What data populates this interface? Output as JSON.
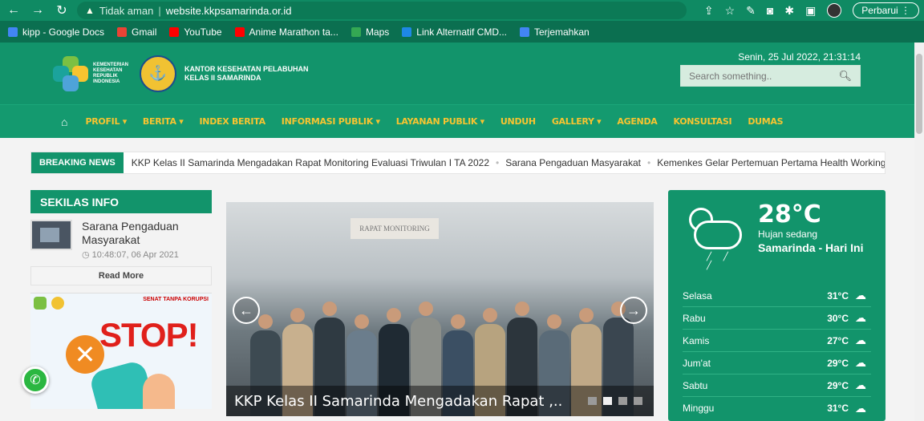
{
  "browser": {
    "insecure_label": "Tidak aman",
    "url": "website.kkpsamarinda.or.id",
    "update_label": "Perbarui"
  },
  "bookmarks": [
    {
      "label": "kipp - Google Docs",
      "color": "#4285f4"
    },
    {
      "label": "Gmail",
      "color": "#ea4335"
    },
    {
      "label": "YouTube",
      "color": "#ff0000"
    },
    {
      "label": "Anime Marathon ta...",
      "color": "#ff0000"
    },
    {
      "label": "Maps",
      "color": "#34a853"
    },
    {
      "label": "Link Alternatif CMD...",
      "color": "#1e88e5"
    },
    {
      "label": "Terjemahkan",
      "color": "#4285f4"
    }
  ],
  "header": {
    "kemenkes_text": "KEMENTERIAN KESEHATAN REPUBLIK INDONESIA",
    "office_line1": "KANTOR KESEHATAN PELABUHAN",
    "office_line2": "KELAS II SAMARINDA",
    "datetime": "Senin, 25 Jul 2022, 21:31:14",
    "search_placeholder": "Search something.."
  },
  "menu": [
    "PROFIL ▾",
    "BERITA ▾",
    "INDEX BERITA",
    "INFORMASI PUBLIK ▾",
    "LAYANAN PUBLIK ▾",
    "UNDUH",
    "GALLERY ▾",
    "AGENDA",
    "KONSULTASI",
    "DUMAS"
  ],
  "breaking": {
    "label": "BREAKING NEWS",
    "items": [
      "KKP Kelas II Samarinda Mengadakan Rapat Monitoring Evaluasi Triwulan I TA 2022",
      "Sarana Pengaduan Masyarakat",
      "Kemenkes Gelar Pertemuan Pertama Health Working Gro"
    ]
  },
  "sidebar": {
    "title": "SEKILAS INFO",
    "item_title": "Sarana Pengaduan Masyarakat",
    "item_time": "10:48:07, 06 Apr 2021",
    "read_more": "Read More",
    "banner_text": "STOP!",
    "banner_small": "SENAT TANPA KORUPSI"
  },
  "slider": {
    "banner_text": "RAPAT MONITORING",
    "caption": "KKP Kelas II Samarinda Mengadakan Rapat ,..",
    "slides": 4,
    "active": 2
  },
  "weather": {
    "temp": "28°C",
    "condition": "Hujan sedang",
    "city": "Samarinda - Hari Ini",
    "forecast": [
      {
        "day": "Selasa",
        "temp": "31°C"
      },
      {
        "day": "Rabu",
        "temp": "30°C"
      },
      {
        "day": "Kamis",
        "temp": "27°C"
      },
      {
        "day": "Jum'at",
        "temp": "29°C"
      },
      {
        "day": "Sabtu",
        "temp": "29°C"
      },
      {
        "day": "Minggu",
        "temp": "31°C"
      }
    ]
  }
}
